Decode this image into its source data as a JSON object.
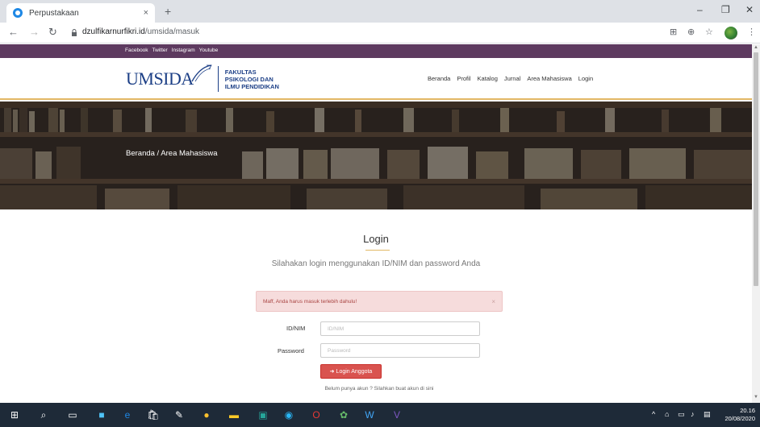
{
  "browser": {
    "tab_title": "Perpustakaan",
    "tab_close": "×",
    "new_tab": "+",
    "url_domain": "dzulfikarnurfikri.id",
    "url_path": "/umsida/masuk",
    "window": {
      "minimize": "–",
      "maximize": "❐",
      "close": "✕"
    }
  },
  "site": {
    "social": [
      "Facebook",
      "Twitter",
      "Instagram",
      "Youtube"
    ],
    "logo_word": "UMSIDA",
    "faculty": [
      "FAKULTAS",
      "PSIKOLOGI DAN",
      "ILMU PENDIDIKAN"
    ],
    "menu": [
      "Beranda",
      "Profil",
      "Katalog",
      "Jurnal",
      "Area Mahasiswa",
      "Login"
    ],
    "breadcrumb": "Beranda / Area Mahasiswa",
    "colors": {
      "topbar": "#5d3a5f",
      "logo": "#1c3f86",
      "accent": "#e2b865",
      "button": "#d9534f"
    }
  },
  "login": {
    "title": "Login",
    "subtitle": "Silahakan login menggunakan ID/NIM dan password Anda",
    "alert": "Maff, Anda harus masuk terlebih dahulu!",
    "alert_close": "×",
    "id_label": "ID/NIM",
    "id_placeholder": "ID/NIM",
    "password_label": "Password",
    "password_placeholder": "Password",
    "button": "Login Anggota",
    "register_text": "Belum punya akun ? Silahkan buat akun di sini"
  },
  "taskbar": {
    "time": "20.16",
    "date": "20/08/2020"
  }
}
